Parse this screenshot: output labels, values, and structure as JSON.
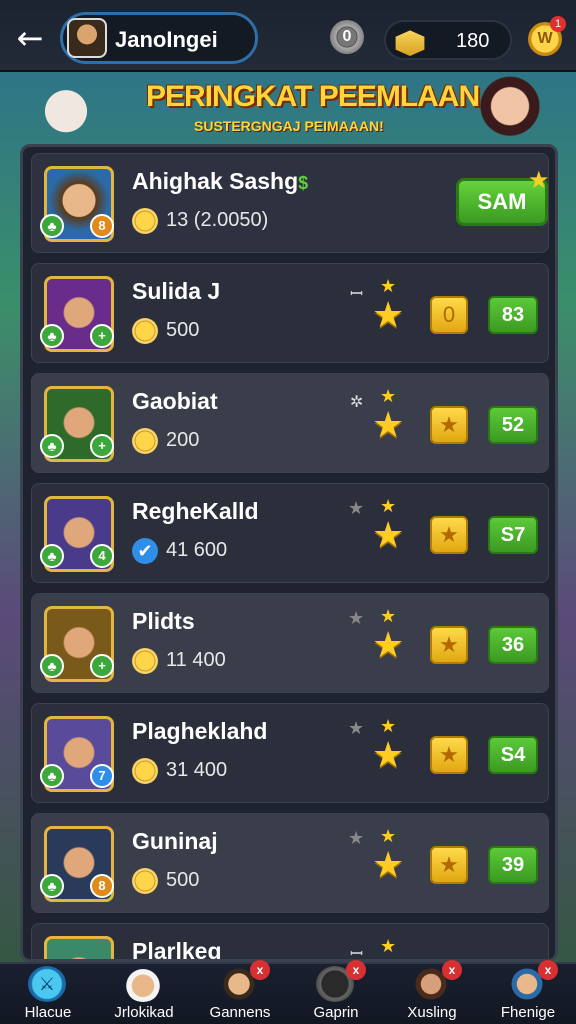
{
  "header": {
    "back_icon": "back-arrow-icon",
    "profile_name": "JanoIngei",
    "zero_coin": "0",
    "gold_amount": "180",
    "notification_count": "1",
    "medal_glyph": "W"
  },
  "banner": {
    "title": "PERINGKAT PEEMLAAN",
    "subtitle": "SUSTERGNGAJ PEIMAAAN!"
  },
  "top_entry": {
    "name": "Ahighak Sashg",
    "name_suffix": "$",
    "score": "13 (2.0050)",
    "button_label": "SAM",
    "badge_right": "8"
  },
  "rows": [
    {
      "name": "Sulida J",
      "score": "500",
      "yellow": "0",
      "green": "83",
      "glyph": "ꟷ",
      "badge_right": "+",
      "badge_color": "#3ca83c",
      "avatar_color": "#6a2c8a"
    },
    {
      "name": "Gaobiat",
      "score": "200",
      "yellow": "★",
      "green": "52",
      "glyph": "✲",
      "badge_right": "+",
      "badge_color": "#3ca83c",
      "avatar_color": "#2e6a2a"
    },
    {
      "name": "RegheKalld",
      "score": "41 600",
      "yellow": "★",
      "green": "S7",
      "glyph": "",
      "badge_right": "4",
      "badge_color": "#3ca83c",
      "avatar_color": "#4a3a8a"
    },
    {
      "name": "Plidts",
      "score": "11 400",
      "yellow": "★",
      "green": "36",
      "glyph": "",
      "badge_right": "+",
      "badge_color": "#3ca83c",
      "avatar_color": "#7a5a1a"
    },
    {
      "name": "Plagheklahd",
      "score": "31 400",
      "yellow": "★",
      "green": "S4",
      "glyph": "",
      "badge_right": "7",
      "badge_color": "#2e8ee8",
      "avatar_color": "#5a4a9a"
    },
    {
      "name": "Guninaj",
      "score": "500",
      "yellow": "★",
      "green": "39",
      "glyph": "",
      "badge_right": "8",
      "badge_color": "#e08a1a",
      "avatar_color": "#2a3a5a"
    },
    {
      "name": "Plarlkeg",
      "score": "",
      "yellow": "",
      "green": "",
      "glyph": "ꟷ",
      "badge_right": "",
      "badge_color": "#3ca83c",
      "avatar_color": "#3a8a6a"
    }
  ],
  "nav": [
    {
      "label": "Hlacue",
      "icon": "globe-icon"
    },
    {
      "label": "Jrlokikad",
      "icon": "chef-avatar-icon"
    },
    {
      "label": "Gannens",
      "icon": "person-avatar-icon"
    },
    {
      "label": "Gaprin",
      "icon": "mask-avatar-icon"
    },
    {
      "label": "Xusling",
      "icon": "warrior-avatar-icon"
    },
    {
      "label": "Fhenige",
      "icon": "player-avatar-icon"
    }
  ],
  "colors": {
    "accent_green": "#4cb82e",
    "accent_gold": "#ffcc22",
    "panel_bg": "#1f2330"
  }
}
